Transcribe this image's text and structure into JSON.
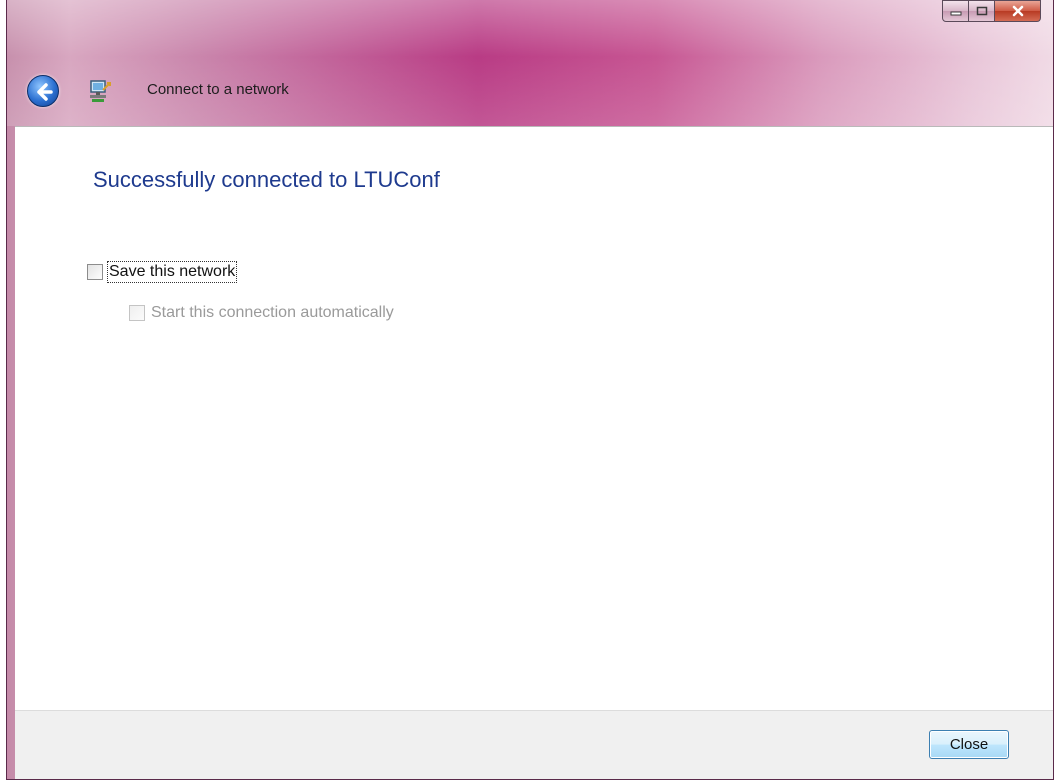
{
  "window": {
    "title": "Connect to a network",
    "caption": {
      "minimize_glyph": "▁",
      "maximize_glyph": "☐",
      "close_glyph": "✕"
    }
  },
  "main": {
    "heading": "Successfully connected to LTUConf",
    "save_network": {
      "label": "Save this network",
      "checked": false
    },
    "start_auto": {
      "label": "Start this connection automatically",
      "checked": false,
      "enabled": false
    }
  },
  "footer": {
    "close_label": "Close"
  },
  "colors": {
    "heading": "#1e3a8e",
    "titlebar_accent": "#b5317e",
    "button_border": "#3c7fb1"
  },
  "icons": {
    "back": "back-arrow-icon",
    "network": "network-icon"
  }
}
